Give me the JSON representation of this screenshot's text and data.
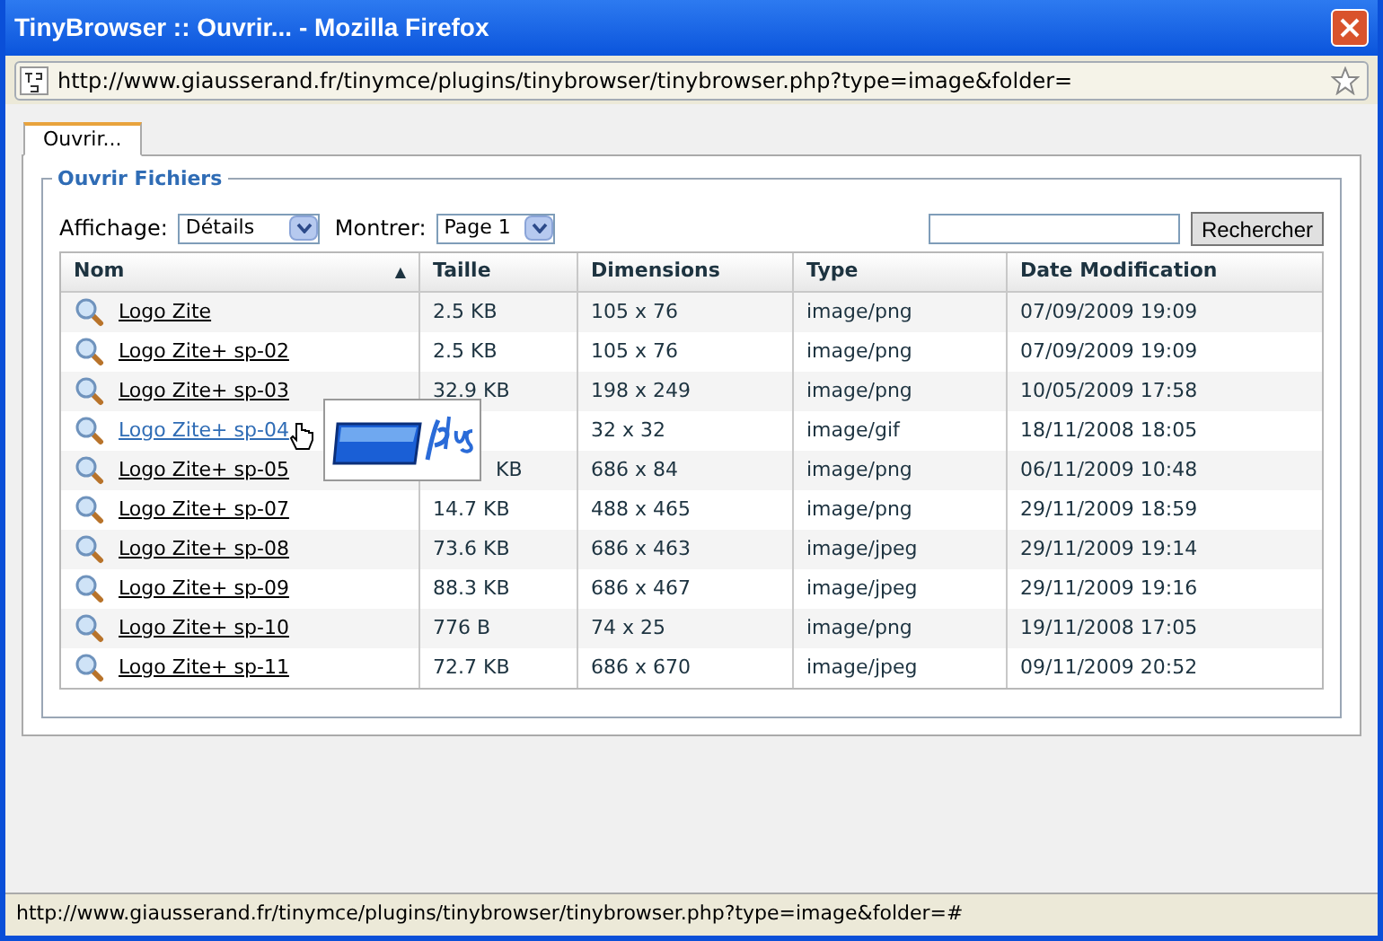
{
  "window": {
    "title": "TinyBrowser :: Ouvrir... - Mozilla Firefox"
  },
  "address_bar": {
    "url": "http://www.giausserand.fr/tinymce/plugins/tinybrowser/tinybrowser.php?type=image&folder="
  },
  "tabs": [
    {
      "label": "Ouvrir...",
      "selected": true
    }
  ],
  "fieldset": {
    "legend": "Ouvrir Fichiers"
  },
  "toolbar": {
    "view_label": "Affichage:",
    "view_value": "Détails",
    "show_label": "Montrer:",
    "show_value": "Page 1",
    "search_button": "Rechercher"
  },
  "table": {
    "columns": [
      {
        "label": "Nom",
        "sort": "▲"
      },
      {
        "label": "Taille"
      },
      {
        "label": "Dimensions"
      },
      {
        "label": "Type"
      },
      {
        "label": "Date Modification"
      }
    ],
    "rows": [
      {
        "name": "Logo Zite",
        "size": "2.5 KB",
        "dimensions": "105 x 76",
        "type": "image/png",
        "date": "07/09/2009 19:09",
        "hovered": false
      },
      {
        "name": "Logo Zite+ sp-02",
        "size": "2.5 KB",
        "dimensions": "105 x 76",
        "type": "image/png",
        "date": "07/09/2009 19:09",
        "hovered": false
      },
      {
        "name": "Logo Zite+ sp-03",
        "size": "32.9 KB",
        "dimensions": "198 x 249",
        "type": "image/png",
        "date": "10/05/2009 17:58",
        "hovered": false
      },
      {
        "name": "Logo Zite+ sp-04",
        "dimensions": "32 x 32",
        "type": "image/gif",
        "date": "18/11/2008 18:05",
        "hovered": true
      },
      {
        "name": "Logo Zite+ sp-05",
        "size": "KB",
        "dimensions": "686 x 84",
        "type": "image/png",
        "date": "06/11/2009 10:48",
        "hovered": false
      },
      {
        "name": "Logo Zite+ sp-07",
        "size": "14.7 KB",
        "dimensions": "488 x 465",
        "type": "image/png",
        "date": "29/11/2009 18:59",
        "hovered": false
      },
      {
        "name": "Logo Zite+ sp-08",
        "size": "73.6 KB",
        "dimensions": "686 x 463",
        "type": "image/jpeg",
        "date": "29/11/2009 19:14",
        "hovered": false
      },
      {
        "name": "Logo Zite+ sp-09",
        "size": "88.3 KB",
        "dimensions": "686 x 467",
        "type": "image/jpeg",
        "date": "29/11/2009 19:16",
        "hovered": false
      },
      {
        "name": "Logo Zite+ sp-10",
        "size": "776 B",
        "dimensions": "74 x 25",
        "type": "image/png",
        "date": "19/11/2008 17:05",
        "hovered": false
      },
      {
        "name": "Logo Zite+ sp-11",
        "size": "72.7 KB",
        "dimensions": "686 x 670",
        "type": "image/jpeg",
        "date": "09/11/2009 20:52",
        "hovered": false
      }
    ]
  },
  "status_bar": {
    "text": "http://www.giausserand.fr/tinymce/plugins/tinybrowser/tinybrowser.php?type=image&folder=#"
  }
}
